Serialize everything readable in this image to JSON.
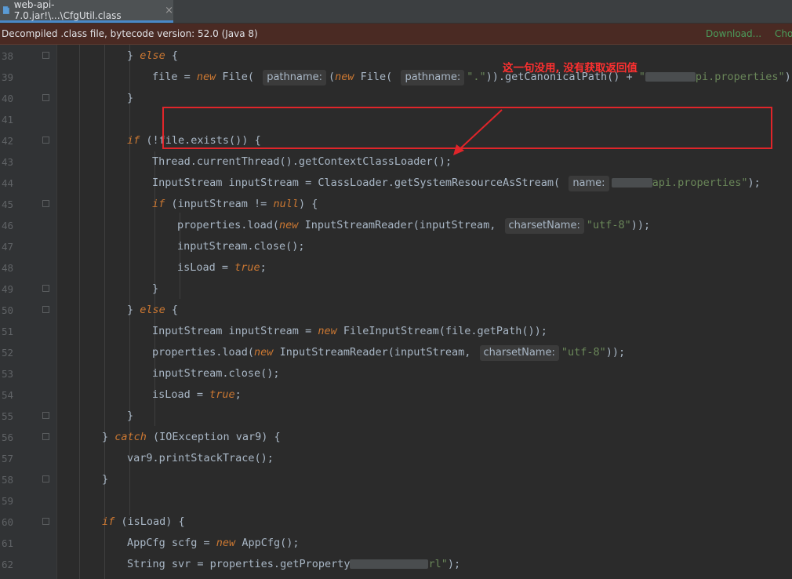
{
  "tab": {
    "title": "web-api-7.0.jar!\\...\\CfgUtil.class",
    "close": "×"
  },
  "banner": {
    "message": "Decompiled .class file, bytecode version: 52.0 (Java 8)",
    "download": "Download...",
    "choose": "Cho"
  },
  "annotation": {
    "text": "这一句没用, 没有获取返回值"
  },
  "lines": [
    {
      "n": "38",
      "indent": 2,
      "segs": [
        [
          "p",
          "} "
        ],
        [
          "k",
          "else"
        ],
        [
          "p",
          " {"
        ]
      ]
    },
    {
      "n": "39",
      "indent": 3,
      "segs": [
        [
          "p",
          "file = "
        ],
        [
          "k",
          "new"
        ],
        [
          "p",
          " File( "
        ],
        [
          "h",
          "pathname:"
        ],
        [
          "p",
          "("
        ],
        [
          "k",
          "new"
        ],
        [
          "p",
          " File( "
        ],
        [
          "h",
          "pathname:"
        ],
        [
          "s",
          "\".\""
        ],
        [
          "p",
          "))."
        ],
        [
          "p",
          "getCanonicalPath() + "
        ],
        [
          "s",
          "\""
        ],
        [
          "b",
          ""
        ],
        [
          "s",
          "pi.properties\""
        ],
        [
          "p",
          ");"
        ]
      ]
    },
    {
      "n": "40",
      "indent": 2,
      "segs": [
        [
          "p",
          "}"
        ]
      ]
    },
    {
      "n": "41",
      "indent": 0,
      "segs": []
    },
    {
      "n": "42",
      "indent": 2,
      "segs": [
        [
          "k",
          "if"
        ],
        [
          "p",
          " (!file.exists()) {"
        ]
      ]
    },
    {
      "n": "43",
      "indent": 3,
      "segs": [
        [
          "p",
          "Thread.currentThread().getContextClassLoader();"
        ]
      ]
    },
    {
      "n": "44",
      "indent": 3,
      "segs": [
        [
          "p",
          "InputStream inputStream = ClassLoader.getSystemResourceAsStream( "
        ],
        [
          "h",
          "name:"
        ],
        [
          "b",
          ""
        ],
        [
          "s",
          "api.properties\""
        ],
        [
          "p",
          ");"
        ]
      ]
    },
    {
      "n": "45",
      "indent": 3,
      "segs": [
        [
          "k",
          "if"
        ],
        [
          "p",
          " (inputStream != "
        ],
        [
          "k",
          "null"
        ],
        [
          "p",
          ") {"
        ]
      ]
    },
    {
      "n": "46",
      "indent": 4,
      "segs": [
        [
          "p",
          "properties.load("
        ],
        [
          "k",
          "new"
        ],
        [
          "p",
          " InputStreamReader(inputStream, "
        ],
        [
          "h",
          "charsetName:"
        ],
        [
          "s",
          "\"utf-8\""
        ],
        [
          "p",
          "));"
        ]
      ]
    },
    {
      "n": "47",
      "indent": 4,
      "segs": [
        [
          "p",
          "inputStream.close();"
        ]
      ]
    },
    {
      "n": "48",
      "indent": 4,
      "segs": [
        [
          "p",
          "isLoad = "
        ],
        [
          "k",
          "true"
        ],
        [
          "p",
          ";"
        ]
      ]
    },
    {
      "n": "49",
      "indent": 3,
      "segs": [
        [
          "p",
          "}"
        ]
      ]
    },
    {
      "n": "50",
      "indent": 2,
      "segs": [
        [
          "p",
          "} "
        ],
        [
          "k",
          "else"
        ],
        [
          "p",
          " {"
        ]
      ]
    },
    {
      "n": "51",
      "indent": 3,
      "segs": [
        [
          "p",
          "InputStream inputStream = "
        ],
        [
          "k",
          "new"
        ],
        [
          "p",
          " FileInputStream(file.getPath());"
        ]
      ]
    },
    {
      "n": "52",
      "indent": 3,
      "segs": [
        [
          "p",
          "properties.load("
        ],
        [
          "k",
          "new"
        ],
        [
          "p",
          " InputStreamReader(inputStream, "
        ],
        [
          "h",
          "charsetName:"
        ],
        [
          "s",
          "\"utf-8\""
        ],
        [
          "p",
          "));"
        ]
      ]
    },
    {
      "n": "53",
      "indent": 3,
      "segs": [
        [
          "p",
          "inputStream.close();"
        ]
      ]
    },
    {
      "n": "54",
      "indent": 3,
      "segs": [
        [
          "p",
          "isLoad = "
        ],
        [
          "k",
          "true"
        ],
        [
          "p",
          ";"
        ]
      ]
    },
    {
      "n": "55",
      "indent": 2,
      "segs": [
        [
          "p",
          "}"
        ]
      ]
    },
    {
      "n": "56",
      "indent": 1,
      "segs": [
        [
          "p",
          "} "
        ],
        [
          "k",
          "catch"
        ],
        [
          "p",
          " (IOException var9) {"
        ]
      ]
    },
    {
      "n": "57",
      "indent": 2,
      "segs": [
        [
          "p",
          "var9.printStackTrace();"
        ]
      ]
    },
    {
      "n": "58",
      "indent": 1,
      "segs": [
        [
          "p",
          "}"
        ]
      ]
    },
    {
      "n": "59",
      "indent": 0,
      "segs": []
    },
    {
      "n": "60",
      "indent": 1,
      "segs": [
        [
          "k",
          "if"
        ],
        [
          "p",
          " (isLoad) {"
        ]
      ]
    },
    {
      "n": "61",
      "indent": 2,
      "segs": [
        [
          "p",
          "AppCfg scfg = "
        ],
        [
          "k",
          "new"
        ],
        [
          "p",
          " AppCfg();"
        ]
      ]
    },
    {
      "n": "62",
      "indent": 2,
      "segs": [
        [
          "p",
          "String svr = properties.getProperty"
        ],
        [
          "b",
          ""
        ],
        [
          "s",
          "rl\""
        ],
        [
          "p",
          ");"
        ]
      ]
    }
  ],
  "colors": {
    "keyword": "#cc7832",
    "string": "#6a8759",
    "text": "#a9b7c6",
    "annotation": "#ff3030",
    "highlight_box": "#e0252a"
  }
}
